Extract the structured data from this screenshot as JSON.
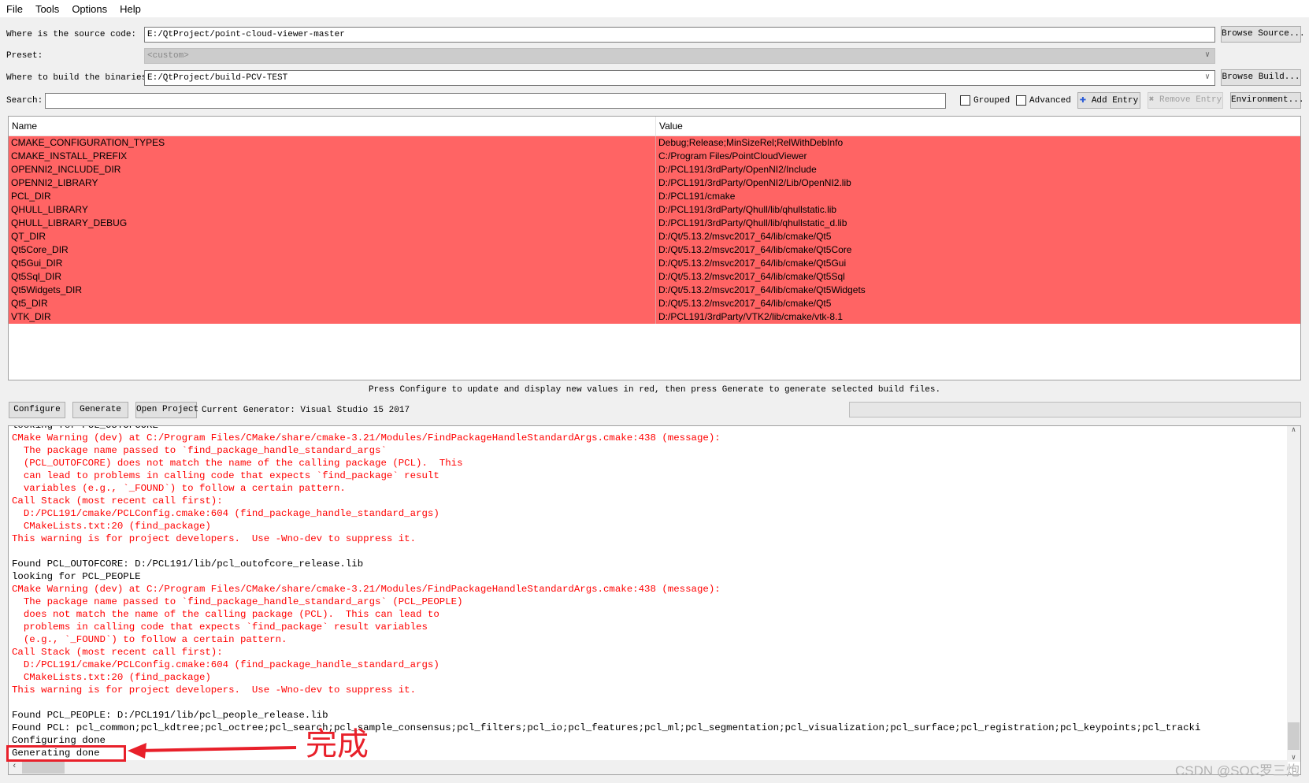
{
  "menu": [
    "File",
    "Tools",
    "Options",
    "Help"
  ],
  "source": {
    "label": "Where is the source code:",
    "value": "E:/QtProject/point-cloud-viewer-master",
    "browse": "Browse Source..."
  },
  "preset": {
    "label": "Preset:",
    "value": "<custom>"
  },
  "build": {
    "label": "Where to build the binaries:",
    "value": "E:/QtProject/build-PCV-TEST",
    "browse": "Browse Build..."
  },
  "search": {
    "label": "Search:",
    "value": ""
  },
  "options": {
    "grouped": "Grouped",
    "advanced": "Advanced",
    "add_entry": "Add Entry",
    "remove_entry": "Remove Entry",
    "environment": "Environment..."
  },
  "table": {
    "headers": [
      "Name",
      "Value"
    ],
    "highlight_color": "#ff6464",
    "rows": [
      [
        "CMAKE_CONFIGURATION_TYPES",
        "Debug;Release;MinSizeRel;RelWithDebInfo"
      ],
      [
        "CMAKE_INSTALL_PREFIX",
        "C:/Program Files/PointCloudViewer"
      ],
      [
        "OPENNI2_INCLUDE_DIR",
        "D:/PCL191/3rdParty/OpenNI2/Include"
      ],
      [
        "OPENNI2_LIBRARY",
        "D:/PCL191/3rdParty/OpenNI2/Lib/OpenNI2.lib"
      ],
      [
        "PCL_DIR",
        "D:/PCL191/cmake"
      ],
      [
        "QHULL_LIBRARY",
        "D:/PCL191/3rdParty/Qhull/lib/qhullstatic.lib"
      ],
      [
        "QHULL_LIBRARY_DEBUG",
        "D:/PCL191/3rdParty/Qhull/lib/qhullstatic_d.lib"
      ],
      [
        "QT_DIR",
        "D:/Qt/5.13.2/msvc2017_64/lib/cmake/Qt5"
      ],
      [
        "Qt5Core_DIR",
        "D:/Qt/5.13.2/msvc2017_64/lib/cmake/Qt5Core"
      ],
      [
        "Qt5Gui_DIR",
        "D:/Qt/5.13.2/msvc2017_64/lib/cmake/Qt5Gui"
      ],
      [
        "Qt5Sql_DIR",
        "D:/Qt/5.13.2/msvc2017_64/lib/cmake/Qt5Sql"
      ],
      [
        "Qt5Widgets_DIR",
        "D:/Qt/5.13.2/msvc2017_64/lib/cmake/Qt5Widgets"
      ],
      [
        "Qt5_DIR",
        "D:/Qt/5.13.2/msvc2017_64/lib/cmake/Qt5"
      ],
      [
        "VTK_DIR",
        "D:/PCL191/3rdParty/VTK2/lib/cmake/vtk-8.1"
      ]
    ]
  },
  "status": "Press Configure to update and display new values in red, then press Generate to generate selected build files.",
  "buttons": {
    "configure": "Configure",
    "generate": "Generate",
    "open_project": "Open Project"
  },
  "generator": "Current Generator: Visual Studio 15 2017",
  "log": [
    {
      "t": "looking for PCL_OUTOFCORE",
      "c": "black"
    },
    {
      "t": "CMake Warning (dev) at C:/Program Files/CMake/share/cmake-3.21/Modules/FindPackageHandleStandardArgs.cmake:438 (message):",
      "c": "red"
    },
    {
      "t": "  The package name passed to `find_package_handle_standard_args`",
      "c": "red"
    },
    {
      "t": "  (PCL_OUTOFCORE) does not match the name of the calling package (PCL).  This",
      "c": "red"
    },
    {
      "t": "  can lead to problems in calling code that expects `find_package` result",
      "c": "red"
    },
    {
      "t": "  variables (e.g., `_FOUND`) to follow a certain pattern.",
      "c": "red"
    },
    {
      "t": "Call Stack (most recent call first):",
      "c": "red"
    },
    {
      "t": "  D:/PCL191/cmake/PCLConfig.cmake:604 (find_package_handle_standard_args)",
      "c": "red"
    },
    {
      "t": "  CMakeLists.txt:20 (find_package)",
      "c": "red"
    },
    {
      "t": "This warning is for project developers.  Use -Wno-dev to suppress it.",
      "c": "red"
    },
    {
      "t": " ",
      "c": "black"
    },
    {
      "t": "Found PCL_OUTOFCORE: D:/PCL191/lib/pcl_outofcore_release.lib",
      "c": "black"
    },
    {
      "t": "looking for PCL_PEOPLE",
      "c": "black"
    },
    {
      "t": "CMake Warning (dev) at C:/Program Files/CMake/share/cmake-3.21/Modules/FindPackageHandleStandardArgs.cmake:438 (message):",
      "c": "red"
    },
    {
      "t": "  The package name passed to `find_package_handle_standard_args` (PCL_PEOPLE)",
      "c": "red"
    },
    {
      "t": "  does not match the name of the calling package (PCL).  This can lead to",
      "c": "red"
    },
    {
      "t": "  problems in calling code that expects `find_package` result variables",
      "c": "red"
    },
    {
      "t": "  (e.g., `_FOUND`) to follow a certain pattern.",
      "c": "red"
    },
    {
      "t": "Call Stack (most recent call first):",
      "c": "red"
    },
    {
      "t": "  D:/PCL191/cmake/PCLConfig.cmake:604 (find_package_handle_standard_args)",
      "c": "red"
    },
    {
      "t": "  CMakeLists.txt:20 (find_package)",
      "c": "red"
    },
    {
      "t": "This warning is for project developers.  Use -Wno-dev to suppress it.",
      "c": "red"
    },
    {
      "t": " ",
      "c": "black"
    },
    {
      "t": "Found PCL_PEOPLE: D:/PCL191/lib/pcl_people_release.lib",
      "c": "black"
    },
    {
      "t": "Found PCL: pcl_common;pcl_kdtree;pcl_octree;pcl_search;pcl_sample_consensus;pcl_filters;pcl_io;pcl_features;pcl_ml;pcl_segmentation;pcl_visualization;pcl_surface;pcl_registration;pcl_keypoints;pcl_tracki",
      "c": "black"
    },
    {
      "t": "Configuring done",
      "c": "black"
    },
    {
      "t": "Generating done",
      "c": "black"
    }
  ],
  "annotation": {
    "text": "完成",
    "color": "#e8202a"
  },
  "watermark": "CSDN @SOC罗三炮"
}
